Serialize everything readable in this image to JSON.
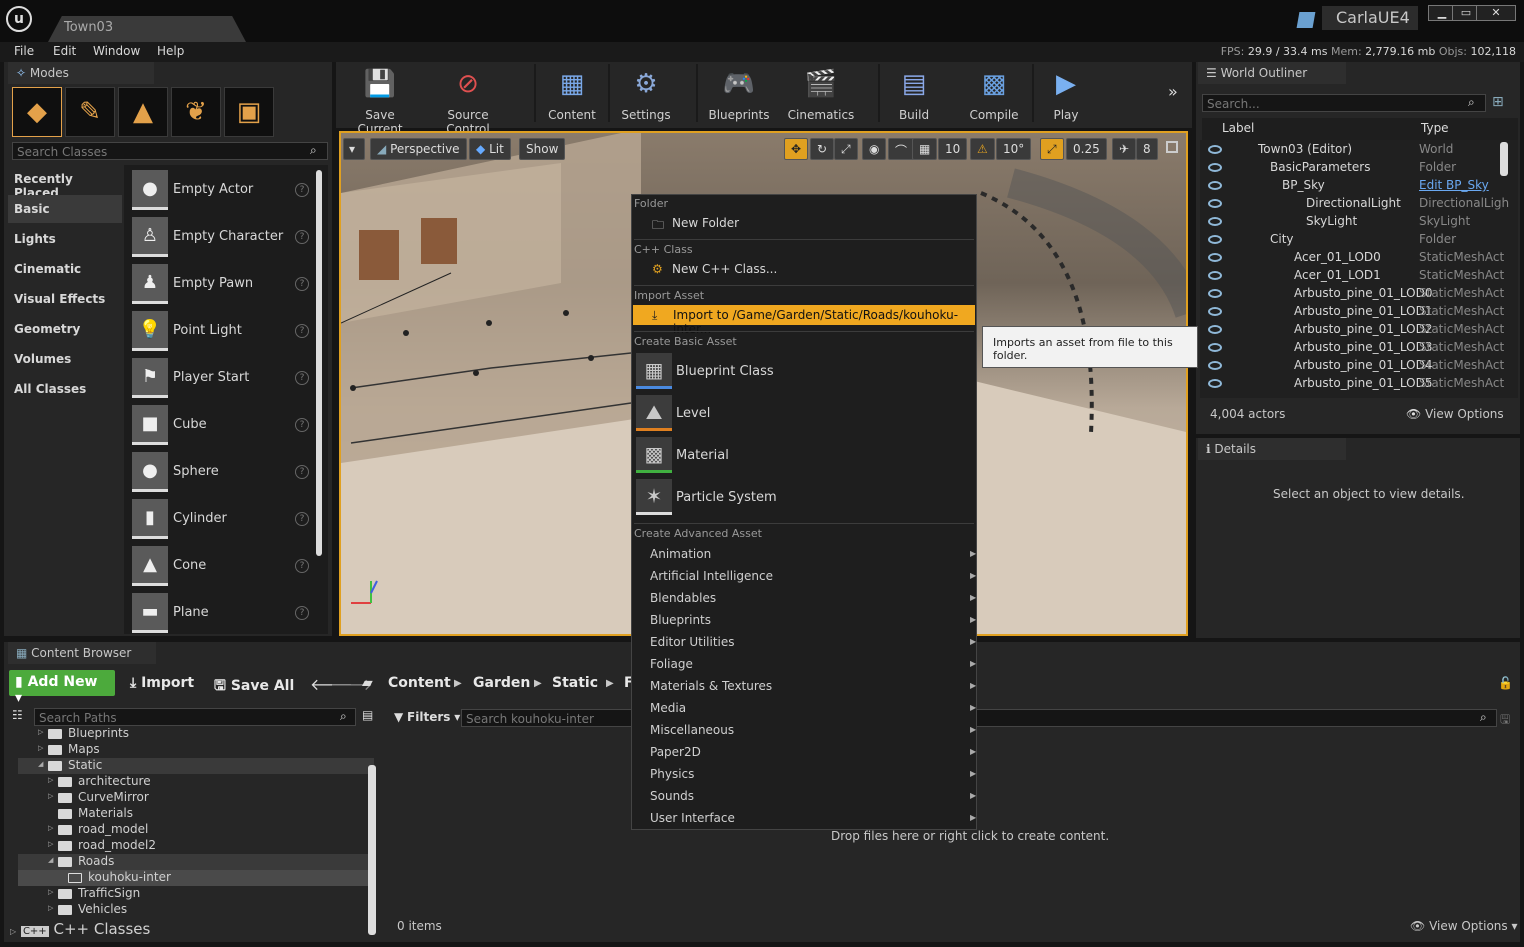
{
  "titlebar": {
    "tab": "Town03",
    "project": "CarlaUE4",
    "min": "▁",
    "max": "▭",
    "close": "✕"
  },
  "menu": [
    "File",
    "Edit",
    "Window",
    "Help"
  ],
  "stats": {
    "fps_label": "FPS:",
    "fps": "29.9",
    "ms": "/ 33.4 ms",
    "mem_label": "Mem:",
    "mem": "2,779.16 mb",
    "objs_label": "Objs:",
    "objs": "102,118"
  },
  "modes": {
    "tab": "Modes",
    "search_placeholder": "Search Classes",
    "categories": [
      "Recently Placed",
      "Basic",
      "Lights",
      "Cinematic",
      "Visual Effects",
      "Geometry",
      "Volumes",
      "All Classes"
    ],
    "items": [
      "Empty Actor",
      "Empty Character",
      "Empty Pawn",
      "Point Light",
      "Player Start",
      "Cube",
      "Sphere",
      "Cylinder",
      "Cone",
      "Plane"
    ]
  },
  "toolbar": [
    "Save Current",
    "Source Control",
    "Content",
    "Settings",
    "Blueprints",
    "Cinematics",
    "Build",
    "Compile",
    "Play"
  ],
  "viewport": {
    "perspective": "Perspective",
    "lit": "Lit",
    "show": "Show",
    "grid": "10",
    "rot": "10°",
    "scale": "0.25",
    "cam": "8"
  },
  "context_menu": {
    "folder_section": "Folder",
    "new_folder": "New Folder",
    "cpp_section": "C++ Class",
    "new_cpp": "New C++ Class...",
    "import_section": "Import Asset",
    "import_to": "Import to /Game/Garden/Static/Roads/kouhoku-inter...",
    "basic_section": "Create Basic Asset",
    "basic": [
      "Blueprint Class",
      "Level",
      "Material",
      "Particle System"
    ],
    "advanced_section": "Create Advanced Asset",
    "advanced": [
      "Animation",
      "Artificial Intelligence",
      "Blendables",
      "Blueprints",
      "Editor Utilities",
      "Foliage",
      "Materials & Textures",
      "Media",
      "Miscellaneous",
      "Paper2D",
      "Physics",
      "Sounds",
      "User Interface"
    ]
  },
  "tooltip": "Imports an asset from file to this folder.",
  "outliner": {
    "tab": "World Outliner",
    "search_placeholder": "Search...",
    "col_label": "Label",
    "col_type": "Type",
    "rows": [
      {
        "name": "Town03 (Editor)",
        "type": "World"
      },
      {
        "name": "BasicParameters",
        "type": "Folder"
      },
      {
        "name": "BP_Sky",
        "type": "Edit BP_Sky"
      },
      {
        "name": "DirectionalLight",
        "type": "DirectionalLigh"
      },
      {
        "name": "SkyLight",
        "type": "SkyLight"
      },
      {
        "name": "City",
        "type": "Folder"
      },
      {
        "name": "Acer_01_LOD0",
        "type": "StaticMeshAct"
      },
      {
        "name": "Acer_01_LOD1",
        "type": "StaticMeshAct"
      },
      {
        "name": "Arbusto_pine_01_LOD0",
        "type": "StaticMeshAct"
      },
      {
        "name": "Arbusto_pine_01_LOD1",
        "type": "StaticMeshAct"
      },
      {
        "name": "Arbusto_pine_01_LOD2",
        "type": "StaticMeshAct"
      },
      {
        "name": "Arbusto_pine_01_LOD3",
        "type": "StaticMeshAct"
      },
      {
        "name": "Arbusto_pine_01_LOD4",
        "type": "StaticMeshAct"
      },
      {
        "name": "Arbusto_pine_01_LOD5",
        "type": "StaticMeshAct"
      }
    ],
    "count": "4,004 actors",
    "view_options": "View Options"
  },
  "details": {
    "tab": "Details",
    "empty": "Select an object to view details."
  },
  "content_browser": {
    "tab": "Content Browser",
    "add_new": "Add New",
    "import": "Import",
    "save_all": "Save All",
    "path": [
      "Content",
      "Garden",
      "Static"
    ],
    "path_cut": "F",
    "search_paths": "Search Paths",
    "filters": "Filters",
    "search_assets": "Search kouhoku-inter",
    "tree": [
      {
        "label": "Blueprints",
        "indent": 0,
        "exp": "▷"
      },
      {
        "label": "Maps",
        "indent": 0,
        "exp": "▷"
      },
      {
        "label": "Static",
        "indent": 0,
        "exp": "◢",
        "open": true
      },
      {
        "label": "architecture",
        "indent": 1,
        "exp": "▷"
      },
      {
        "label": "CurveMirror",
        "indent": 1,
        "exp": "▷"
      },
      {
        "label": "Materials",
        "indent": 1,
        "exp": ""
      },
      {
        "label": "road_model",
        "indent": 1,
        "exp": "▷"
      },
      {
        "label": "road_model2",
        "indent": 1,
        "exp": "▷"
      },
      {
        "label": "Roads",
        "indent": 1,
        "exp": "◢",
        "open": true
      },
      {
        "label": "kouhoku-inter",
        "indent": 2,
        "exp": "",
        "sel": true
      },
      {
        "label": "TrafficSign",
        "indent": 1,
        "exp": "▷"
      },
      {
        "label": "Vehicles",
        "indent": 1,
        "exp": "▷"
      }
    ],
    "cpp_classes": "C++ Classes",
    "drop_hint": "Drop files here or right click to create content.",
    "items_count": "0 items",
    "view_options": "View Options"
  }
}
